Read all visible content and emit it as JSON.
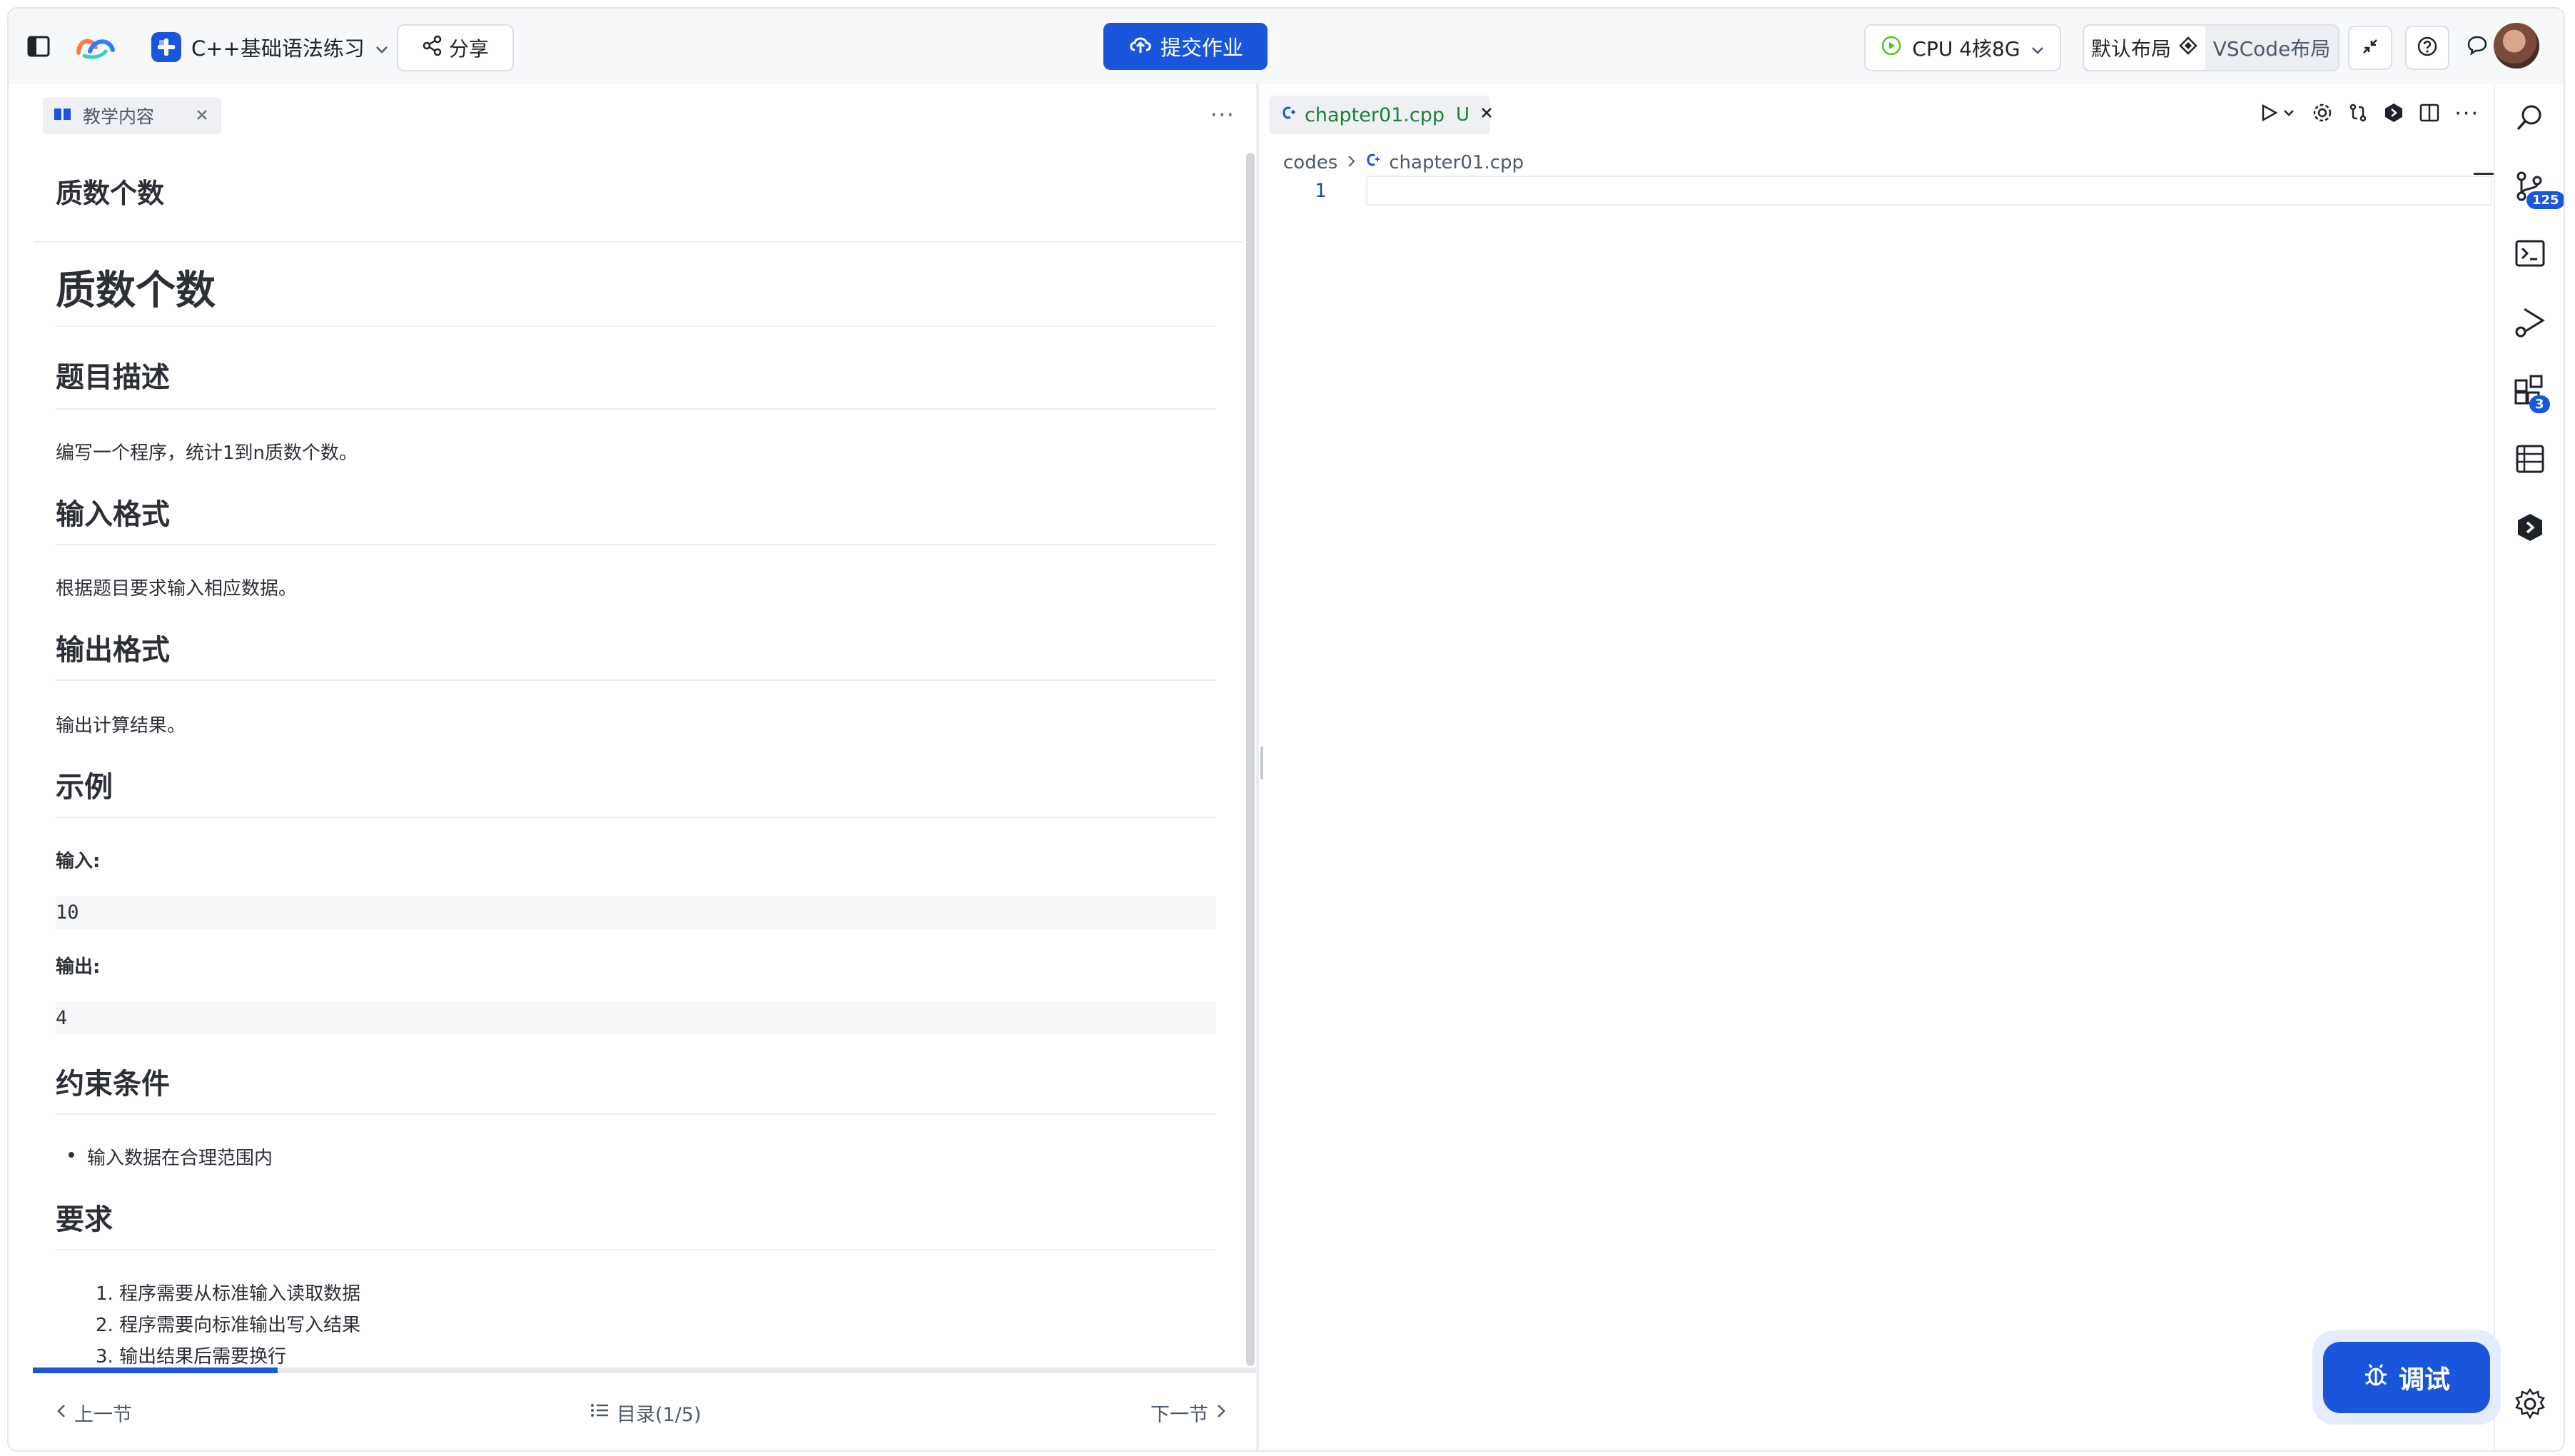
{
  "topbar": {
    "project_title": "C++基础语法练习",
    "share_label": "分享",
    "submit_label": "提交作业",
    "cpu_label": "CPU 4核8G",
    "layout_default": "默认布局",
    "layout_vscode": "VSCode布局"
  },
  "left_panel": {
    "tab_label": "教学内容",
    "more": "···",
    "doc": {
      "header_title": "质数个数",
      "h1": "质数个数",
      "desc_heading": "题目描述",
      "desc_text": "编写一个程序，统计1到n质数个数。",
      "input_heading": "输入格式",
      "input_text": "根据题目要求输入相应数据。",
      "output_heading": "输出格式",
      "output_text": "输出计算结果。",
      "example_heading": "示例",
      "example_input_label": "输入:",
      "example_input": "10",
      "example_output_label": "输出:",
      "example_output": "4",
      "constraints_heading": "约束条件",
      "constraints": [
        "输入数据在合理范围内"
      ],
      "requirements_heading": "要求",
      "requirements": [
        "1. 程序需要从标准输入读取数据",
        "2. 程序需要向标准输出写入结果",
        "3. 输出结果后需要换行"
      ]
    },
    "progress": 0.2,
    "footer": {
      "prev": "上一节",
      "toc": "目录(1/5)",
      "next": "下一节"
    }
  },
  "editor": {
    "tab_filename": "chapter01.cpp",
    "tab_status": "U",
    "breadcrumb_folder": "codes",
    "breadcrumb_file": "chapter01.cpp",
    "line_number": "1"
  },
  "activity_bar": {
    "source_control_badge": "125",
    "extensions_badge": "3"
  },
  "debug_button_label": "调试",
  "colors": {
    "accent": "#1a56db",
    "modified_file": "#1a7f37"
  }
}
